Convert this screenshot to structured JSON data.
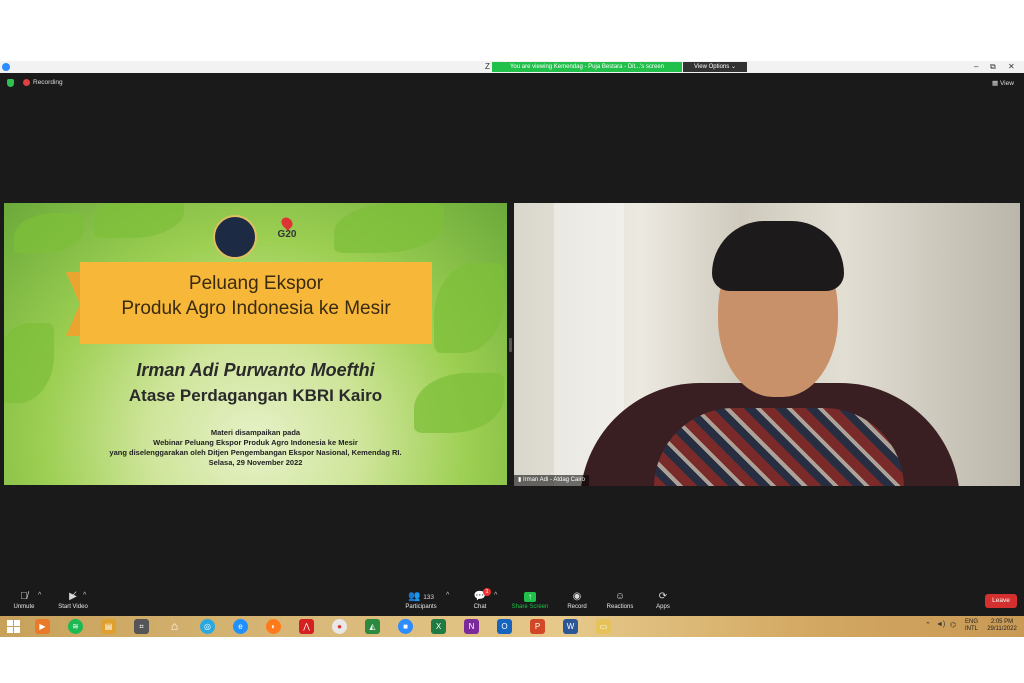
{
  "window": {
    "title_fragment": "Z",
    "sharing_banner": "You are viewing Kemendag - Puja Bestara - Dit...'s screen",
    "view_options": "View Options",
    "controls": [
      "–",
      "⧉",
      "✕"
    ]
  },
  "meeting": {
    "recording_label": "Recording",
    "view_label": "View"
  },
  "slide": {
    "title_line1": "Peluang Ekspor",
    "title_line2": "Produk Agro Indonesia ke Mesir",
    "presenter_name": "Irman Adi Purwanto Moefthi",
    "presenter_role": "Atase Perdagangan KBRI Kairo",
    "note_line1": "Materi disampaikan pada",
    "note_line2": "Webinar Peluang Ekspor Produk Agro Indonesia ke Mesir",
    "note_line3": "yang diselenggarakan oleh Ditjen Pengembangan Ekspor Nasional, Kemendag RI.",
    "note_line4": "Selasa, 29 November 2022",
    "g20_label": "G20"
  },
  "camera": {
    "participant_name": "Irman Adi - Atdag Cairo"
  },
  "toolbar": {
    "unmute": "Unmute",
    "start_video": "Start Video",
    "participants": "Participants",
    "participants_count": "133",
    "chat": "Chat",
    "chat_badge": "1",
    "share_screen": "Share Screen",
    "record": "Record",
    "reactions": "Reactions",
    "apps": "Apps",
    "leave": "Leave"
  },
  "taskbar": {
    "lang_line1": "ENG",
    "lang_line2": "INTL",
    "time": "2:05 PM",
    "date": "29/11/2022"
  },
  "colors": {
    "share_green": "#20c04a",
    "leave_red": "#d3302f",
    "ribbon_orange": "#f7b83a"
  }
}
